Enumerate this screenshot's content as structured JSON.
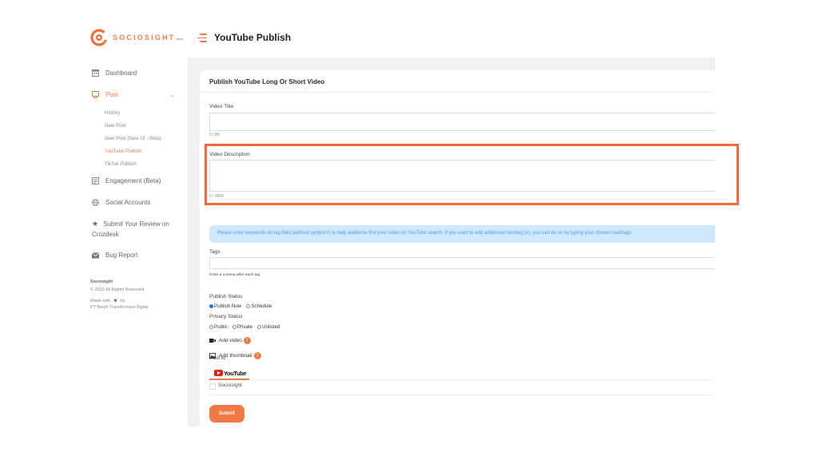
{
  "brand": {
    "name": "SOCIOSIGHT",
    "suffix": "beta",
    "accent_color": "#f07a45"
  },
  "header": {
    "menu_icon": "hamburger-icon",
    "title": "YouTube Publish"
  },
  "sidebar": {
    "items": [
      {
        "label": "Dashboard",
        "icon": "dashboard-icon"
      },
      {
        "label": "Post",
        "icon": "post-icon",
        "active": true,
        "expanded": true
      },
      {
        "label": "Engagement (Beta)",
        "icon": "engagement-icon"
      },
      {
        "label": "Social Accounts",
        "icon": "globe-icon"
      },
      {
        "label": "Submit Your Review on Crozdesk",
        "icon": "star-icon"
      },
      {
        "label": "Bug Report",
        "icon": "mail-icon"
      }
    ],
    "post_subitems": [
      {
        "label": "History"
      },
      {
        "label": "New Post"
      },
      {
        "label": "New Post (New UI - Beta)"
      },
      {
        "label": "YouTube Publish",
        "active": true
      },
      {
        "label": "TikTok Publish"
      }
    ],
    "footer": {
      "company": "Sociosight",
      "copyright": "© 2023 All Rights Reserved",
      "made_with": "Made with",
      "by": "by",
      "org": "PT Benih Transformasi Digital"
    }
  },
  "form": {
    "card_title": "Publish YouTube Long Or Short Video",
    "video_title": {
      "label": "Video Title",
      "value": "",
      "counter": "0 / 80"
    },
    "video_description": {
      "label": "Video Description",
      "value": "",
      "counter": "0 / 4500"
    },
    "info_banner": "Please enter keywords on tag field (without symbol #) to help audience find your video on YouTube search. If you want to add additional hashtag (#), you can do so by typing your chosen hashtags",
    "tags": {
      "label": "Tags",
      "value": "",
      "helper": "Enter a comma after each tag"
    },
    "publish_status": {
      "label": "Publish Status",
      "options": [
        {
          "label": "Publish Now",
          "checked": true
        },
        {
          "label": "Schedule",
          "checked": false
        }
      ]
    },
    "privacy_status": {
      "label": "Privacy Status",
      "options": [
        {
          "label": "Public",
          "checked": false
        },
        {
          "label": "Private",
          "checked": false
        },
        {
          "label": "Unlisted",
          "checked": false
        }
      ]
    },
    "add_video": {
      "label": "Add video",
      "badge": "!"
    },
    "add_thumbnail": {
      "label": "Add thumbnail",
      "badge": "!"
    },
    "post_to": {
      "label": "Post to :",
      "platform_tab": "YouTube",
      "accounts": [
        {
          "name": "Sociosight",
          "checked": false
        }
      ]
    },
    "submit_label": "Submit"
  },
  "highlight": {
    "target": "video-description",
    "color": "#f26b38"
  }
}
